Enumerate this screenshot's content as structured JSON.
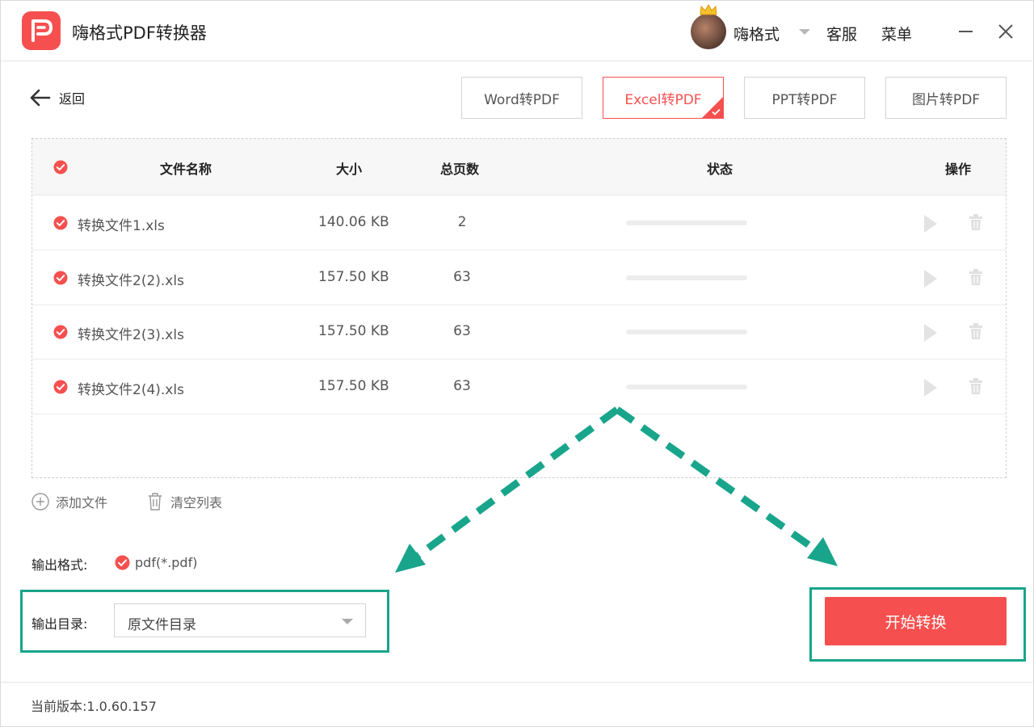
{
  "app": {
    "title": "嗨格式PDF转换器"
  },
  "header": {
    "username": "嗨格式",
    "service_label": "客服",
    "menu_label": "菜单"
  },
  "toolbar": {
    "back_label": "返回",
    "tabs": [
      {
        "label": "Word转PDF",
        "active": false
      },
      {
        "label": "Excel转PDF",
        "active": true
      },
      {
        "label": "PPT转PDF",
        "active": false
      },
      {
        "label": "图片转PDF",
        "active": false
      }
    ]
  },
  "table": {
    "headers": {
      "name": "文件名称",
      "size": "大小",
      "pages": "总页数",
      "status": "状态",
      "actions": "操作"
    },
    "rows": [
      {
        "name": "转换文件1.xls",
        "size": "140.06 KB",
        "pages": "2",
        "progress": 0
      },
      {
        "name": "转换文件2(2).xls",
        "size": "157.50 KB",
        "pages": "63",
        "progress": 0
      },
      {
        "name": "转换文件2(3).xls",
        "size": "157.50 KB",
        "pages": "63",
        "progress": 0
      },
      {
        "name": "转换文件2(4).xls",
        "size": "157.50 KB",
        "pages": "63",
        "progress": 0
      }
    ]
  },
  "actions": {
    "add_files": "添加文件",
    "clear_list": "清空列表"
  },
  "output": {
    "format_label": "输出格式:",
    "format_value": "pdf(*.pdf)",
    "dir_label": "输出目录:",
    "dir_value": "原文件目录"
  },
  "start_button": "开始转换",
  "footer": {
    "version": "当前版本:1.0.60.157"
  },
  "colors": {
    "accent": "#f5504f",
    "highlight": "#19a58b"
  },
  "icons": [
    "app-logo-icon",
    "crown-icon",
    "chevron-down-icon",
    "minimize-icon",
    "close-icon",
    "arrow-left-icon",
    "check-circle-icon",
    "play-icon",
    "trash-icon",
    "plus-circle-icon"
  ]
}
